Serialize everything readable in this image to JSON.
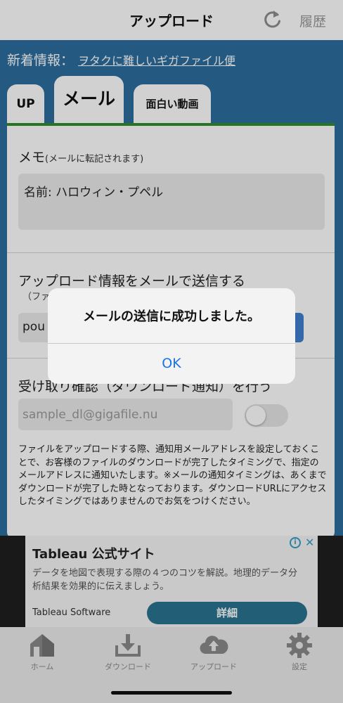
{
  "header": {
    "title": "アップロード",
    "history_label": "履歴",
    "refresh_icon": "refresh-icon"
  },
  "news": {
    "label": "新着情報：",
    "link_text": "ヲタクに難しいギガファイル便"
  },
  "tabs": [
    {
      "label": "UP",
      "active": false
    },
    {
      "label": "メール",
      "active": true
    },
    {
      "label": "面白い動画",
      "active": false
    }
  ],
  "memo": {
    "label": "メモ",
    "note": "(メールに転記されます)",
    "value": "名前: ハロウィン・プペル"
  },
  "send_info": {
    "label": "アップロード情報をメールで送信する",
    "sub": "（ファ",
    "value": "pou"
  },
  "confirm": {
    "label": "受け取り確認（ダウンロード通知）を行う",
    "placeholder": "sample_dl@gigafile.nu",
    "enabled": false
  },
  "note": "ファイルをアップロードする際、通知用メールアドレスを設定しておくことで、お客様のファイルのダウンロードが完了したタイミングで、指定のメールアドレスに通知いたします。※メールの通知タイミングは、あくまでダウンロードが完了した時となっております。ダウンロードURLにアクセスしたタイミングではありませんのでお気をつけください。",
  "ad": {
    "title": "Tableau 公式サイト",
    "description": "データを地図で表現する際の４つのコツを解説。地理的データ分析結果を効果的に伝えましょう。",
    "source": "Tableau Software",
    "button_label": "詳細",
    "info_glyph": "i",
    "close_glyph": "✕"
  },
  "bottom_nav": [
    {
      "label": "ホーム",
      "icon": "home-icon"
    },
    {
      "label": "ダウンロード",
      "icon": "download-icon"
    },
    {
      "label": "アップロード",
      "icon": "cloud-upload-icon"
    },
    {
      "label": "設定",
      "icon": "gear-icon"
    }
  ],
  "alert": {
    "message": "メールの送信に成功しました。",
    "ok_label": "OK"
  },
  "colors": {
    "primary_blue": "#2c6e9e",
    "tab_accent_green": "#2f8f2a",
    "link_blue": "#1a73e8",
    "ad_button": "#2a7590"
  }
}
